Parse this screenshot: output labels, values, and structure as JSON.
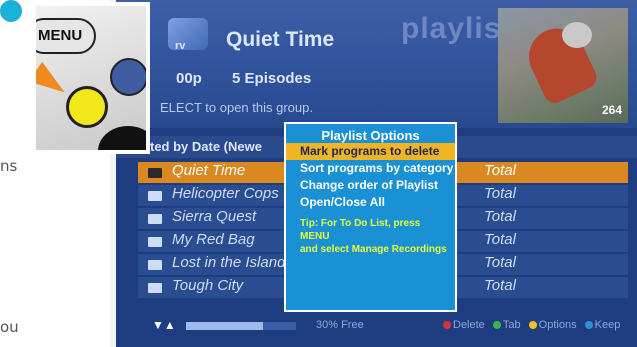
{
  "page_fragments": {
    "left_top": "ns",
    "left_bottom": "ou"
  },
  "screen": {
    "logo": "rv",
    "screen_title": "playlist",
    "group_title": "Quiet Time",
    "time": "00p",
    "episodes": "5 Episodes",
    "hint": "ELECT to open this group.",
    "thumbnail_channel": "264",
    "sort_label": "ted by Date (Newe",
    "rows": [
      {
        "name": "Quiet Time",
        "total": "Total",
        "selected": true
      },
      {
        "name": "Helicopter Cops",
        "total": "Total",
        "selected": false
      },
      {
        "name": "Sierra Quest",
        "total": "Total",
        "selected": false
      },
      {
        "name": "My Red Bag",
        "total": "Total",
        "selected": false
      },
      {
        "name": "Lost in the Island",
        "total": "Total",
        "selected": false
      },
      {
        "name": "Tough City",
        "total": "Total",
        "selected": false
      }
    ],
    "disk": {
      "free_text": "30% Free",
      "used_fraction": 0.7
    },
    "legend": {
      "delete": "Delete",
      "tab": "Tab",
      "options": "Options",
      "keep": "Keep",
      "colors": {
        "delete": "#d8323a",
        "tab": "#39b54a",
        "options": "#f3c21c",
        "keep": "#2f8fd8"
      }
    }
  },
  "popup": {
    "title": "Playlist Options",
    "items": [
      "Mark programs to delete",
      "Sort programs by category",
      "Change order of Playlist",
      "Open/Close All"
    ],
    "tip_line1": "Tip: For To Do List, press MENU",
    "tip_line2": "and select Manage Recordings"
  },
  "remote": {
    "menu_label": "MENU",
    "highlight_color": "#f3e81a"
  }
}
